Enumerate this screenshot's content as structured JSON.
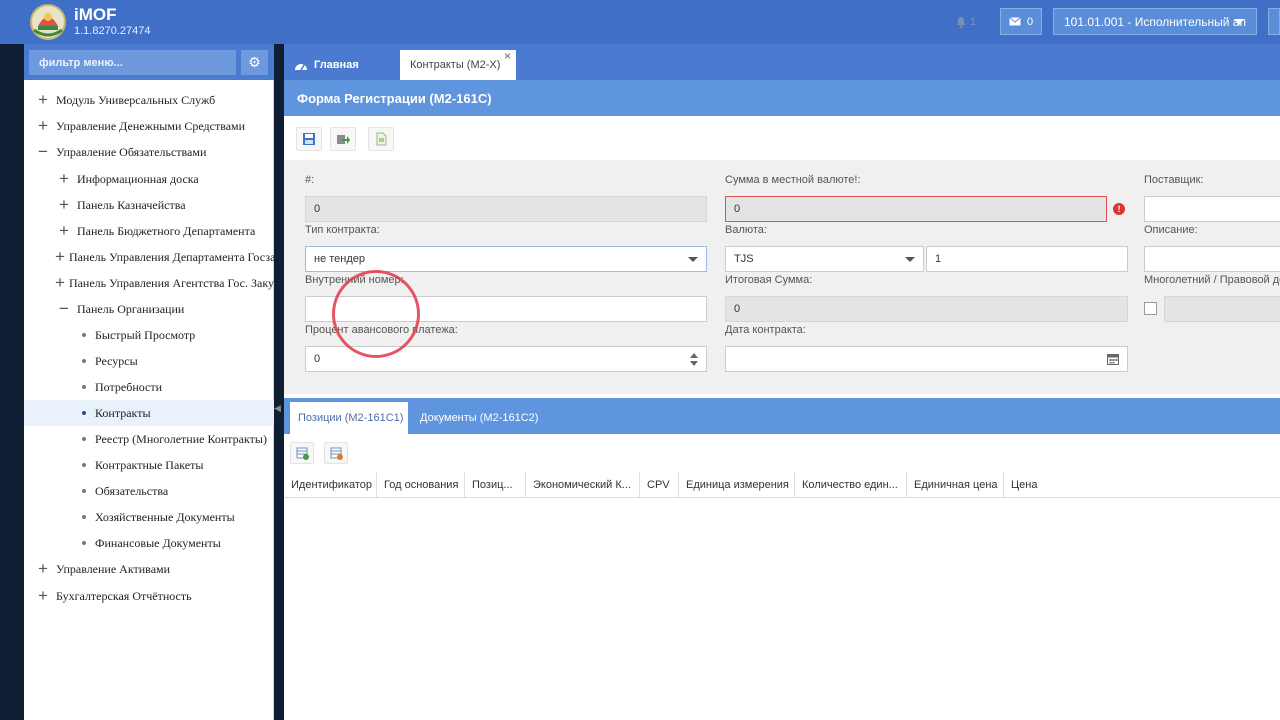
{
  "app": {
    "title": "iMOF",
    "version": "1.1.8270.27474"
  },
  "header": {
    "notif_count": "1",
    "msg_count": "0",
    "org_selector": "101.01.001 - Исполнительный ап"
  },
  "sidebar": {
    "filter_placeholder": "фильтр меню...",
    "items": [
      {
        "label": "Модуль Универсальных Служб",
        "icon": "plus-icon"
      },
      {
        "label": "Управление Денежными Средствами",
        "icon": "plus-icon"
      },
      {
        "label": "Управление Обязательствами",
        "icon": "minus-icon"
      },
      {
        "label": "Информационная доска",
        "icon": "plus-icon"
      },
      {
        "label": "Панель Казначейства",
        "icon": "plus-icon"
      },
      {
        "label": "Панель Бюджетного Департамента",
        "icon": "plus-icon"
      },
      {
        "label": "Панель Управления Департамента Госзакупок",
        "icon": "plus-icon"
      },
      {
        "label": "Панель Управления Агентства Гос. Закупок",
        "icon": "plus-icon"
      },
      {
        "label": "Панель Организации",
        "icon": "minus-icon"
      },
      {
        "label": "Быстрый Просмотр",
        "icon": "bullet-icon"
      },
      {
        "label": "Ресурсы",
        "icon": "bullet-icon"
      },
      {
        "label": "Потребности",
        "icon": "bullet-icon"
      },
      {
        "label": "Контракты",
        "icon": "bullet-icon",
        "active": true
      },
      {
        "label": "Реестр (Многолетние Контракты)",
        "icon": "bullet-icon"
      },
      {
        "label": "Контрактные Пакеты",
        "icon": "bullet-icon"
      },
      {
        "label": "Обязательства",
        "icon": "bullet-icon"
      },
      {
        "label": "Хозяйственные Документы",
        "icon": "bullet-icon"
      },
      {
        "label": "Финансовые Документы",
        "icon": "bullet-icon"
      },
      {
        "label": "Управление Активами",
        "icon": "plus-icon"
      },
      {
        "label": "Бухгалтерская Отчётность",
        "icon": "plus-icon"
      }
    ]
  },
  "tabs": {
    "home": "Главная",
    "contracts": "Контракты (M2-X)",
    "close": "×"
  },
  "form": {
    "title": "Форма Регистрации (M2-161C)",
    "number_label": "#:",
    "number_value": "0",
    "local_sum_label": "Сумма в местной валюте!:",
    "local_sum_value": "0",
    "supplier_label": "Поставщик:",
    "contract_type_label": "Тип контракта:",
    "contract_type_value": "не тендер",
    "currency_label": "Валюта:",
    "currency_value": "TJS",
    "rate_value": "1",
    "description_label": "Описание:",
    "internal_number_label": "Внутренний номер:",
    "total_sum_label": "Итоговая Сумма:",
    "total_sum_value": "0",
    "multiyear_label": "Многолетний / Правовой до",
    "advance_percent_label": "Процент авансового платежа:",
    "advance_percent_value": "0",
    "contract_date_label": "Дата контракта:"
  },
  "subtabs": {
    "positions": "Позиции (M2-161C1)",
    "documents": "Документы (M2-161C2)"
  },
  "grid": {
    "columns": [
      "Идентификатор",
      "Год основания",
      "Позиц...",
      "Экономический К...",
      "CPV",
      "Единица измерения",
      "Количество един...",
      "Единичная цена",
      "Цена"
    ]
  }
}
